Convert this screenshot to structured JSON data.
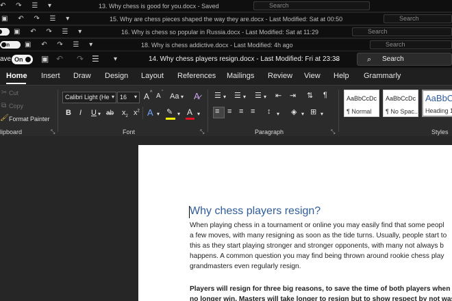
{
  "stacked_windows": [
    {
      "title": "13. Why chess is good for you.docx  -  Saved",
      "search": "Search"
    },
    {
      "title": "15. Why are chess pieces shaped the way they are.docx  -  Last Modified: Sat at 00:50",
      "search": "Search"
    },
    {
      "title": "16. Why is chess so popular in Russia.docx  -  Last Modified: Sat at 11:29",
      "search": "Search"
    },
    {
      "title": "18. Why is chess addictive.docx  -  Last Modified: 4h ago",
      "search": "Search",
      "toggle": "On"
    }
  ],
  "titlebar": {
    "autosave_label": "ave",
    "autosave_toggle": "On",
    "document_title": "14. Why chess players resign.docx  -  Last Modified: Fri at 23:38",
    "search_placeholder": "Search"
  },
  "tabs": [
    "Home",
    "Insert",
    "Draw",
    "Design",
    "Layout",
    "References",
    "Mailings",
    "Review",
    "View",
    "Help",
    "Grammarly"
  ],
  "active_tab": "Home",
  "ribbon": {
    "clipboard": {
      "cut": "Cut",
      "copy": "Copy",
      "format_painter": "Format Painter",
      "label": "lipboard"
    },
    "font": {
      "name": "Calibri Light (He",
      "size": "16",
      "label": "Font",
      "grow": "A",
      "shrink": "A",
      "case": "Aa",
      "bold": "B",
      "italic": "I",
      "underline": "U",
      "strike": "ab",
      "subscript": "x",
      "superscript": "x"
    },
    "paragraph": {
      "label": "Paragraph"
    },
    "styles": {
      "label": "Styles",
      "items": [
        {
          "sample": "AaBbCcDc",
          "name": "¶ Normal"
        },
        {
          "sample": "AaBbCcDc",
          "name": "¶ No Spac..."
        },
        {
          "sample": "AaBbC",
          "name": "Heading 1"
        }
      ]
    }
  },
  "document": {
    "heading": "Why chess players resign?",
    "paragraph1": [
      "When playing chess in a tournament or online you may easily find that some peopl",
      "a few moves, with many resigning as soon as the tide turns. Usually, people start to",
      "this as they start playing stronger and stronger opponents, with many not always b",
      "happens. A common question you may find being thrown around rookie chess play",
      "grandmasters even regularly resign."
    ],
    "paragraph2": [
      "Players will resign for three big reasons, to save the time of both players when th",
      "no longer win. Masters will take longer to resign but to show respect by not wasti"
    ]
  },
  "colors": {
    "accent_heading": "#2e5c9a",
    "titlebar": "#0f0f0f",
    "ribbon": "#2b2b2b",
    "page": "#ffffff",
    "highlight": "#ffff00",
    "font_color": "#e81123"
  }
}
